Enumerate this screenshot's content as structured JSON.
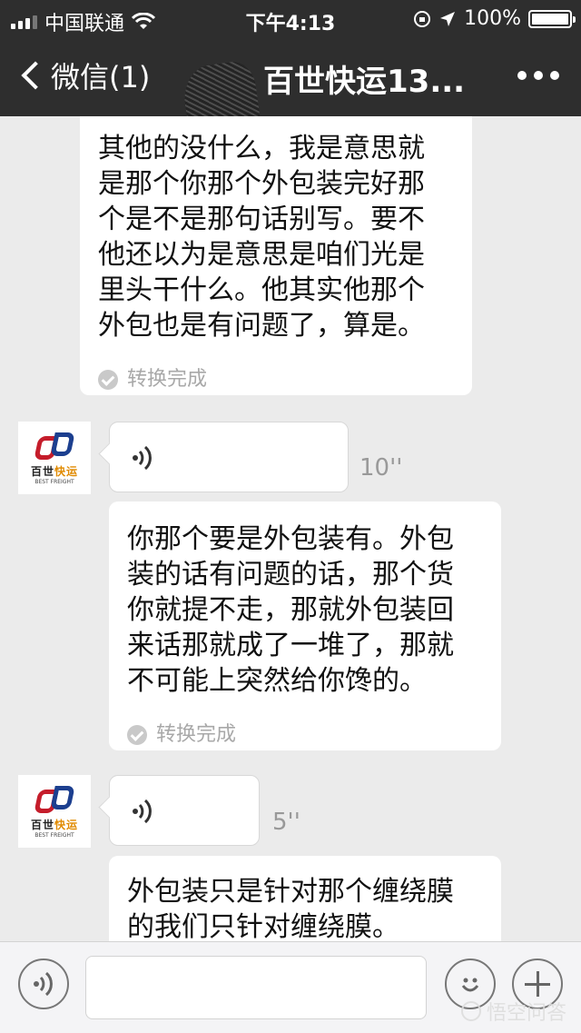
{
  "status_bar": {
    "carrier": "中国联通",
    "time": "下午4:13",
    "battery": "100%"
  },
  "nav": {
    "back_label": "微信(1)",
    "title": "百世快运13..."
  },
  "messages": [
    {
      "type": "transcript",
      "text": "其他的没什么，我是意思就\n是那个你那个外包装完好那\n个是不是那句话别写。要不\n他还以为是意思是咱们光是\n里头干什么。他其实他那个\n外包也是有问题了，算是。",
      "status": "转换完成"
    },
    {
      "type": "voice",
      "duration": "10''"
    },
    {
      "type": "transcript",
      "text": "你那个要是外包装有。外包\n装的话有问题的话，那个货\n你就提不走，那就外包装回\n来话那就成了一堆了，那就\n不可能上突然给你馋的。",
      "status": "转换完成"
    },
    {
      "type": "voice",
      "duration": "5''"
    },
    {
      "type": "transcript",
      "text": "外包装只是针对那个缠绕膜\n的我们只针对缠绕膜。",
      "status": ""
    }
  ],
  "avatar": {
    "name_cn_prefix": "百世",
    "name_cn_highlight": "快运",
    "name_en": "BEST FREIGHT"
  },
  "watermark": "悟空问答",
  "colors": {
    "header_bg": "#2e2e2e",
    "chat_bg": "#ebebeb",
    "bubble_bg": "#ffffff",
    "brand_red": "#c51d2b",
    "brand_blue": "#1c3f8f",
    "brand_orange": "#e08a00"
  },
  "icons": {
    "back": "chevron-left-icon",
    "more": "more-dots-icon",
    "voice_wave": "voice-wave-icon",
    "voice_toggle": "voice-input-icon",
    "emoji": "smile-icon",
    "plus": "plus-icon"
  }
}
